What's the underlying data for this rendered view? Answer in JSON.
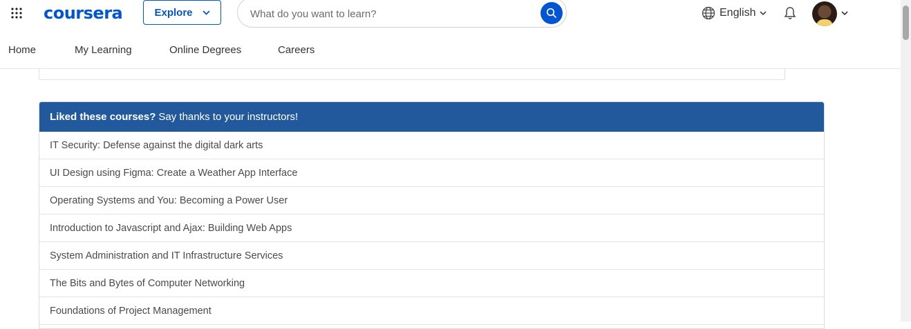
{
  "header": {
    "logo": "coursera",
    "explore_label": "Explore",
    "search_placeholder": "What do you want to learn?",
    "language": "English"
  },
  "nav": {
    "items": [
      "Home",
      "My Learning",
      "Online Degrees",
      "Careers"
    ]
  },
  "panel": {
    "title_bold": "Liked these courses?",
    "title_rest": "Say thanks to your instructors!",
    "courses": [
      "IT Security: Defense against the digital dark arts",
      "UI Design using Figma: Create a Weather App Interface",
      "Operating Systems and You: Becoming a Power User",
      "Introduction to Javascript and Ajax: Building Web Apps",
      "System Administration and IT Infrastructure Services",
      "The Bits and Bytes of Computer Networking",
      "Foundations of Project Management"
    ]
  },
  "icons": {
    "apps": "apps-grid-icon",
    "explore_chevron": "chevron-down-icon",
    "search": "search-icon",
    "language": "globe-icon",
    "notifications": "bell-icon",
    "profile_chevron": "chevron-down-icon"
  },
  "colors": {
    "brand": "#0056d2",
    "panel_header": "#22599d"
  }
}
